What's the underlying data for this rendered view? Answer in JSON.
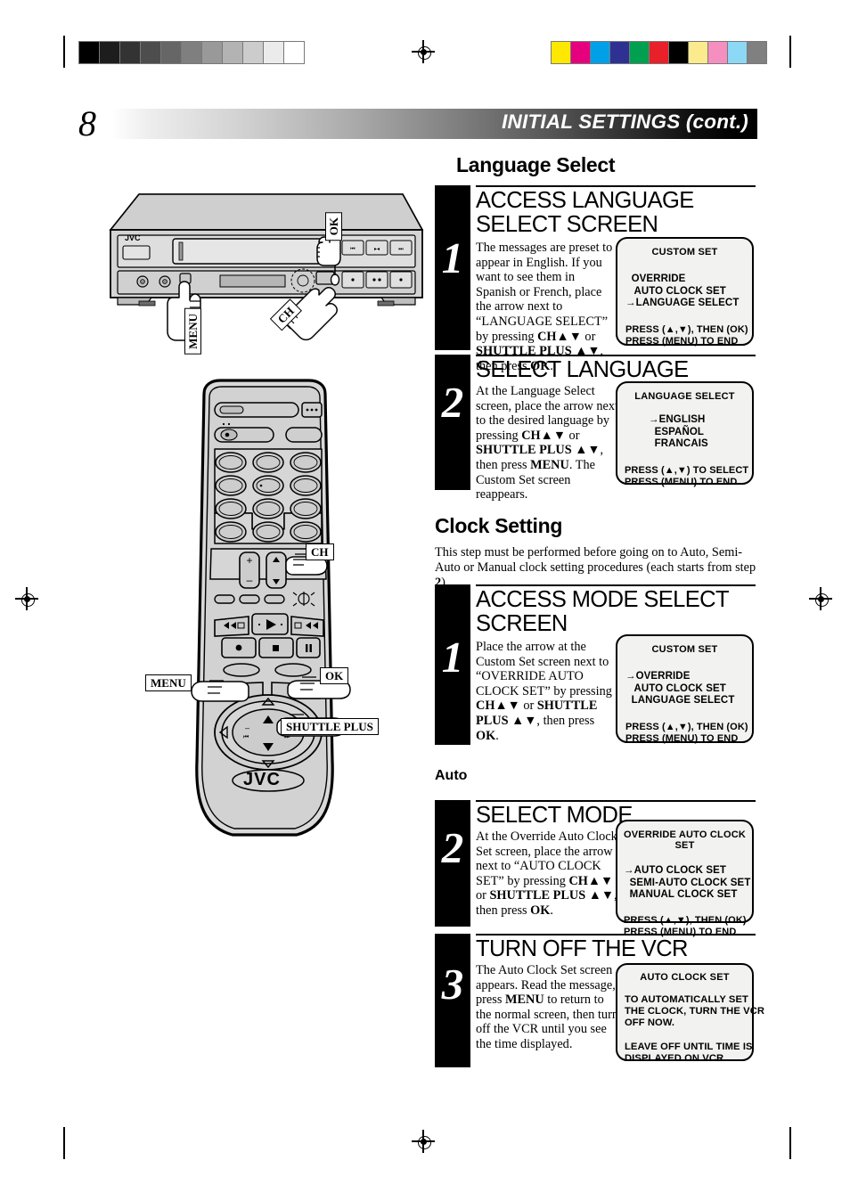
{
  "page": {
    "number": "8",
    "header_title": "INITIAL SETTINGS (cont.)"
  },
  "sections": {
    "language": {
      "title": "Language Select"
    },
    "clock": {
      "title": "Clock Setting",
      "intro_line1": "This step must be performed before going on to Auto, Semi-Auto",
      "intro_line2a": "or Manual clock setting procedures (each starts from step ",
      "intro_step_ref": "2",
      "intro_line2b": ")."
    },
    "auto": {
      "title": "Auto"
    }
  },
  "steps": [
    {
      "number": "1",
      "heading": "ACCESS LANGUAGE SELECT SCREEN",
      "body_html": "The messages are preset to appear in English. If you want to see them in Spanish or French, place the arrow next to “LANGUAGE SELECT” by pressing <b>CH▲▼</b> or <b>SHUTTLE PLUS ▲▼</b>, then press <b>OK</b>.",
      "osd": {
        "title": "CUSTOM SET",
        "list": "  OVERRIDE\n   AUTO CLOCK SET\n→LANGUAGE SELECT",
        "footer": "PRESS (▲,▼), THEN (OK)\nPRESS (MENU) TO END"
      }
    },
    {
      "number": "2",
      "heading": "SELECT LANGUAGE",
      "body_html": "At the Language Select screen, place the arrow next to the desired language by pressing <b>CH▲▼</b> or <b>SHUTTLE PLUS ▲▼</b>, then press <b>MENU</b>. The Custom Set screen reappears.",
      "osd": {
        "title": "LANGUAGE SELECT",
        "list": "→ENGLISH\n  ESPAÑOL\n  FRANCAIS",
        "footer": "PRESS (▲,▼) TO SELECT\nPRESS (MENU) TO END"
      }
    },
    {
      "number": "1",
      "heading": "ACCESS MODE SELECT SCREEN",
      "body_html": "Place the arrow at the Custom Set screen next to “OVERRIDE AUTO CLOCK SET” by pressing <b>CH▲▼</b> or <b>SHUTTLE PLUS ▲▼</b>, then press <b>OK</b>.",
      "osd": {
        "title": "CUSTOM SET",
        "list": "→OVERRIDE\n   AUTO CLOCK SET\n  LANGUAGE SELECT",
        "footer": "PRESS (▲,▼), THEN (OK)\nPRESS (MENU) TO END"
      }
    },
    {
      "number": "2",
      "heading": "SELECT MODE",
      "body_html": "At the Override Auto Clock Set screen, place the arrow next to “AUTO CLOCK SET” by pressing <b>CH▲▼</b> or <b>SHUTTLE PLUS ▲▼</b>, then press <b>OK</b>.",
      "osd": {
        "title": "OVERRIDE AUTO CLOCK SET",
        "list": "→AUTO CLOCK SET\n  SEMI-AUTO CLOCK SET\n  MANUAL CLOCK SET",
        "footer": "PRESS (▲,▼), THEN (OK)\nPRESS (MENU) TO END"
      }
    },
    {
      "number": "3",
      "heading": "TURN OFF THE VCR",
      "body_html": "The Auto Clock Set screen appears. Read the message, press <b>MENU</b> to return to the normal screen, then turn off the VCR until you see the time displayed.",
      "osd": {
        "title": "AUTO CLOCK SET",
        "para1": "TO AUTOMATICALLY SET\nTHE CLOCK, TURN THE VCR\nOFF NOW.",
        "para2": "LEAVE OFF UNTIL TIME IS\nDISPLAYED ON VCR."
      }
    }
  ],
  "illustrations": {
    "vcr": {
      "brand": "JVC",
      "callout_ok": "OK",
      "callout_menu": "MENU",
      "callout_ch": "CH"
    },
    "remote": {
      "brand": "JVC",
      "callout_ch": "CH",
      "callout_menu": "MENU",
      "callout_ok": "OK",
      "callout_shuttle": "SHUTTLE PLUS"
    }
  },
  "print_marks": {
    "grayscale": [
      "#000000",
      "#1d1d1d",
      "#333333",
      "#4d4d4d",
      "#666666",
      "#7f7f7f",
      "#999999",
      "#b3b3b3",
      "#cccccc",
      "#ebebeb",
      "#ffffff"
    ],
    "colorbar": [
      "#ffe800",
      "#e6007e",
      "#00a0e9",
      "#2e3192",
      "#00a050",
      "#e8202a",
      "#000000",
      "#fbeb8c",
      "#f播",
      "#8cd8f5",
      "#808080"
    ],
    "colorbar_fixed": [
      "#ffe800",
      "#e6007e",
      "#00a0e9",
      "#2e3192",
      "#00a050",
      "#e8202a",
      "#000000",
      "#fbeb8c",
      "#f48fc0",
      "#8cd8f5",
      "#808080"
    ]
  }
}
